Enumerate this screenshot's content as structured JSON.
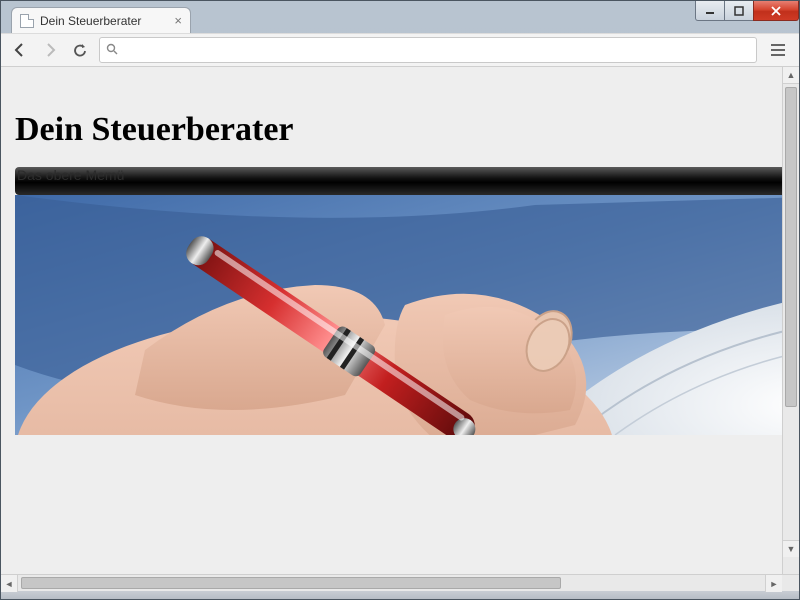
{
  "window": {
    "tab_title": "Dein Steuerberater"
  },
  "toolbar": {
    "url": ""
  },
  "page": {
    "site_title": "Dein Steuerberater",
    "menu_label": "Das obere Memü"
  }
}
